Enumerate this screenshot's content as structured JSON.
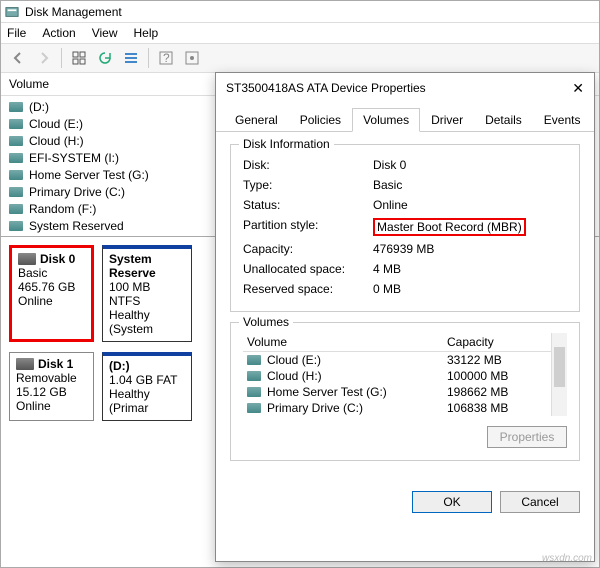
{
  "window": {
    "title": "Disk Management"
  },
  "menu": {
    "file": "File",
    "action": "Action",
    "view": "View",
    "help": "Help"
  },
  "volume_list": {
    "header": "Volume",
    "items": [
      {
        "label": "(D:)"
      },
      {
        "label": "Cloud (E:)"
      },
      {
        "label": "Cloud (H:)"
      },
      {
        "label": "EFI-SYSTEM (I:)"
      },
      {
        "label": "Home Server Test (G:)"
      },
      {
        "label": "Primary Drive (C:)"
      },
      {
        "label": "Random (F:)"
      },
      {
        "label": "System Reserved"
      }
    ]
  },
  "disks": [
    {
      "name": "Disk 0",
      "type": "Basic",
      "size": "465.76 GB",
      "status": "Online",
      "highlight": true,
      "partitions": [
        {
          "title": "System Reserve",
          "line2": "100 MB NTFS",
          "line3": "Healthy (System"
        }
      ]
    },
    {
      "name": "Disk 1",
      "type": "Removable",
      "size": "15.12 GB",
      "status": "Online",
      "highlight": false,
      "partitions": [
        {
          "title": "(D:)",
          "line2": "1.04 GB FAT",
          "line3": "Healthy (Primar"
        }
      ]
    }
  ],
  "properties": {
    "title": "ST3500418AS ATA Device Properties",
    "tabs": {
      "general": "General",
      "policies": "Policies",
      "volumes": "Volumes",
      "driver": "Driver",
      "details": "Details",
      "events": "Events"
    },
    "disk_info": {
      "group_title": "Disk Information",
      "disk_k": "Disk:",
      "disk_v": "Disk 0",
      "type_k": "Type:",
      "type_v": "Basic",
      "status_k": "Status:",
      "status_v": "Online",
      "pstyle_k": "Partition style:",
      "pstyle_v": "Master Boot Record (MBR)",
      "cap_k": "Capacity:",
      "cap_v": "476939 MB",
      "unalloc_k": "Unallocated space:",
      "unalloc_v": "4 MB",
      "res_k": "Reserved space:",
      "res_v": "0 MB"
    },
    "volumes": {
      "group_title": "Volumes",
      "col_vol": "Volume",
      "col_cap": "Capacity",
      "rows": [
        {
          "name": "Cloud (E:)",
          "cap": "33122 MB"
        },
        {
          "name": "Cloud (H:)",
          "cap": "100000 MB"
        },
        {
          "name": "Home Server Test  (G:)",
          "cap": "198662 MB"
        },
        {
          "name": "Primary Drive (C:)",
          "cap": "106838 MB"
        }
      ]
    },
    "props_btn": "Properties",
    "ok": "OK",
    "cancel": "Cancel"
  },
  "watermark": "wsxdn.com"
}
